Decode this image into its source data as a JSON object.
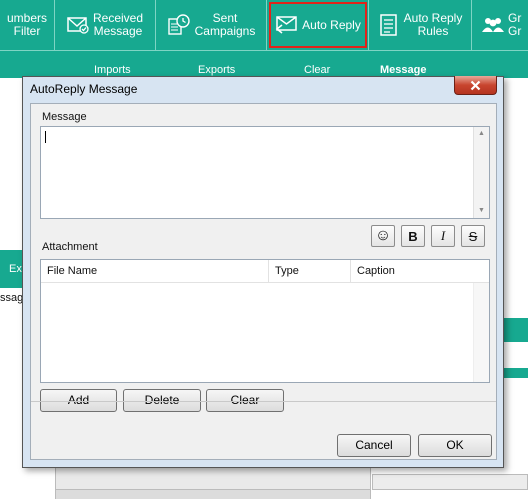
{
  "toolbar": {
    "items": [
      {
        "label": "umbers\nFilter",
        "icon": "filter-icon"
      },
      {
        "label": "Received\nMessage",
        "icon": "envelope-check-icon"
      },
      {
        "label": "Sent\nCampaigns",
        "icon": "clock-list-icon"
      },
      {
        "label": "Auto Reply",
        "icon": "envelope-reply-icon"
      },
      {
        "label": "Auto Reply\nRules",
        "icon": "document-rules-icon"
      },
      {
        "label": "Gr\nGr",
        "icon": "group-icon"
      }
    ],
    "highlighted": "Auto Reply"
  },
  "subbar": {
    "imports_label": "Imports",
    "exports_label": "Exports",
    "clear_label": "Clear",
    "message_label": "Message"
  },
  "left": {
    "green_label": "Ex",
    "message_label": "ssage"
  },
  "dialog": {
    "title": "AutoReply Message",
    "message_label": "Message",
    "message_value": "",
    "attachment_label": "Attachment",
    "format_buttons": [
      {
        "name": "emoji",
        "glyph": "☺"
      },
      {
        "name": "bold",
        "glyph": "B"
      },
      {
        "name": "italic",
        "glyph": "I"
      },
      {
        "name": "strikethrough",
        "glyph": "S"
      }
    ],
    "columns": [
      "File Name",
      "Type",
      "Caption"
    ],
    "rows": [],
    "add_label": "Add",
    "delete_label": "Delete",
    "clear_label": "Clear",
    "cancel_label": "Cancel",
    "ok_label": "OK"
  },
  "colors": {
    "toolbar": "#17a990",
    "highlight": "#e2231a",
    "close": "#c8452f",
    "dialog_frame": "#d7e4f2"
  }
}
